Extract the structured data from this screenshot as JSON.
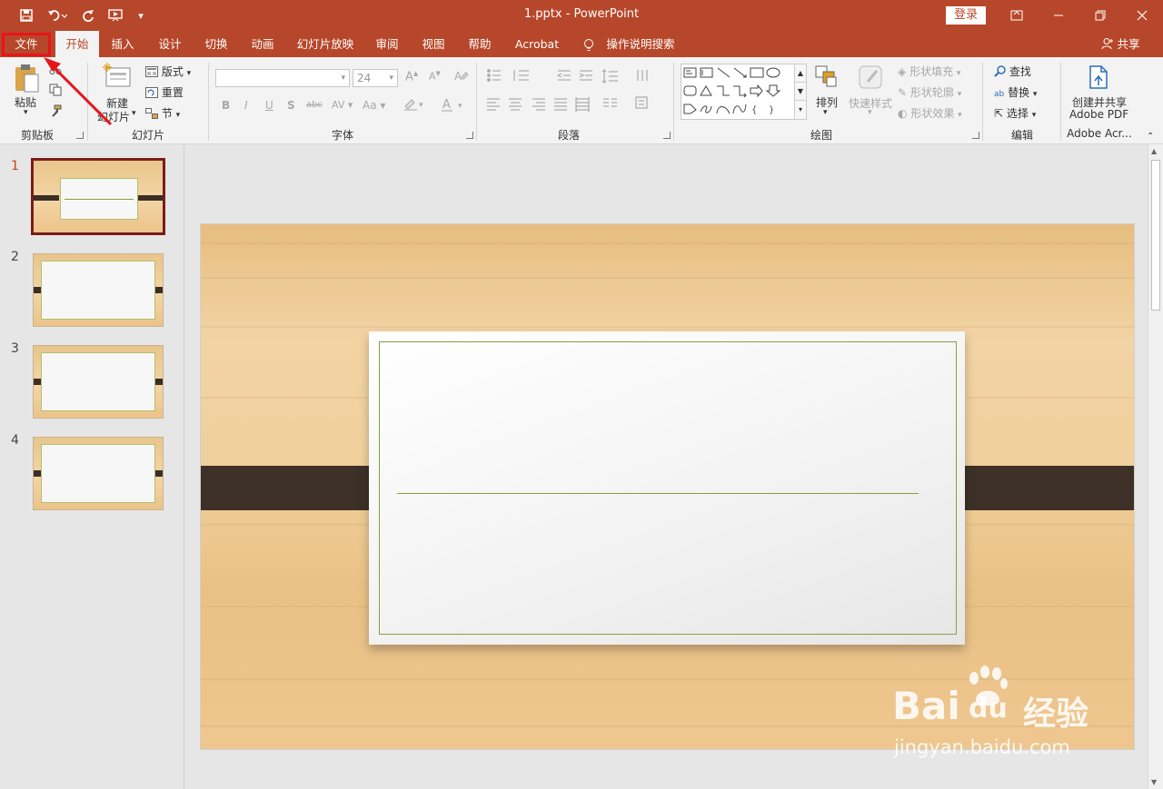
{
  "titlebar": {
    "doc_title": "1.pptx  -  PowerPoint",
    "login_label": "登录"
  },
  "tabs": [
    {
      "label": "文件"
    },
    {
      "label": "开始"
    },
    {
      "label": "插入"
    },
    {
      "label": "设计"
    },
    {
      "label": "切换"
    },
    {
      "label": "动画"
    },
    {
      "label": "幻灯片放映"
    },
    {
      "label": "审阅"
    },
    {
      "label": "视图"
    },
    {
      "label": "帮助"
    },
    {
      "label": "Acrobat"
    },
    {
      "label": "操作说明搜索"
    }
  ],
  "share_label": "共享",
  "ribbon": {
    "clipboard": {
      "paste": "粘贴",
      "group": "剪贴板"
    },
    "slides": {
      "new_line1": "新建",
      "new_line2": "幻灯片",
      "layout": "版式",
      "reset": "重置",
      "section": "节",
      "group": "幻灯片"
    },
    "font": {
      "size": "24",
      "group": "字体"
    },
    "paragraph": {
      "group": "段落"
    },
    "drawing": {
      "arrange": "排列",
      "quick_styles": "快速样式",
      "fill": "形状填充",
      "outline": "形状轮廓",
      "effects": "形状效果",
      "group": "绘图"
    },
    "editing": {
      "find": "查找",
      "replace": "替换",
      "select": "选择",
      "group": "编辑"
    },
    "acrobat": {
      "line1": "创建并共享",
      "line2": "Adobe PDF",
      "group": "Adobe Acr..."
    }
  },
  "thumbnails": [
    {
      "num": "1",
      "active": true
    },
    {
      "num": "2",
      "active": false
    },
    {
      "num": "3",
      "active": false
    },
    {
      "num": "4",
      "active": false
    }
  ],
  "watermark": {
    "brand": "Bai",
    "brand2": "du",
    "cn": "经验",
    "url": "jingyan.baidu.com"
  },
  "colors": {
    "accent": "#b7472a",
    "highlight": "#e8141a"
  }
}
